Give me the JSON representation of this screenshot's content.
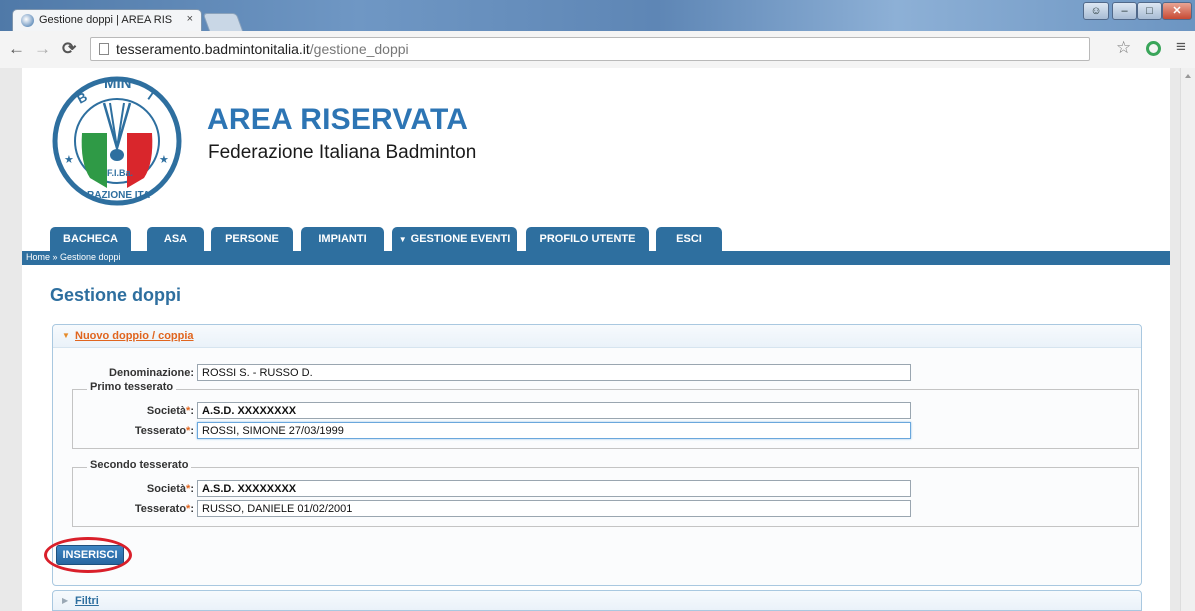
{
  "browser": {
    "tab_title": "Gestione doppi | AREA RIS",
    "tab_close": "×",
    "url_host": "tesseramento.badmintonitalia.it",
    "url_path": "/gestione_doppi"
  },
  "header": {
    "title": "AREA RISERVATA",
    "subtitle": "Federazione Italiana Badminton",
    "logo_text": {
      "top": "BADMINTON",
      "bottom": "FEDERAZIONE ITALIANA",
      "center": "F.I.Ba."
    }
  },
  "nav": {
    "tabs": [
      {
        "label": "BACHECA"
      },
      {
        "label": "ASA"
      },
      {
        "label": "PERSONE"
      },
      {
        "label": "IMPIANTI"
      },
      {
        "label": "GESTIONE EVENTI",
        "caret": "▼"
      },
      {
        "label": "PROFILO UTENTE"
      },
      {
        "label": "ESCI"
      }
    ],
    "breadcrumb": "Home » Gestione doppi"
  },
  "main": {
    "page_title": "Gestione doppi",
    "panel": {
      "header_link": "Nuovo doppio / coppia",
      "denominazione_label": "Denominazione:",
      "denominazione_value": "ROSSI S. - RUSSO D.",
      "primo": {
        "legend": "Primo tesserato",
        "societa_label": "Società",
        "societa_value": "A.S.D. XXXXXXXX",
        "tesserato_label": "Tesserato",
        "tesserato_value": "ROSSI, SIMONE 27/03/1999"
      },
      "secondo": {
        "legend": "Secondo tesserato",
        "societa_label": "Società",
        "societa_value": "A.S.D. XXXXXXXX",
        "tesserato_label": "Tesserato",
        "tesserato_value": "RUSSO, DANIELE 01/02/2001"
      },
      "required_mark": "*",
      "colon": ":",
      "submit_label": "INSERISCI"
    },
    "filters_link": "Filtri"
  },
  "colors": {
    "brand_blue": "#2e6f9f",
    "title_blue": "#2d75b4",
    "accent_orange": "#e0651f",
    "highlight_red": "#d91f2a"
  }
}
